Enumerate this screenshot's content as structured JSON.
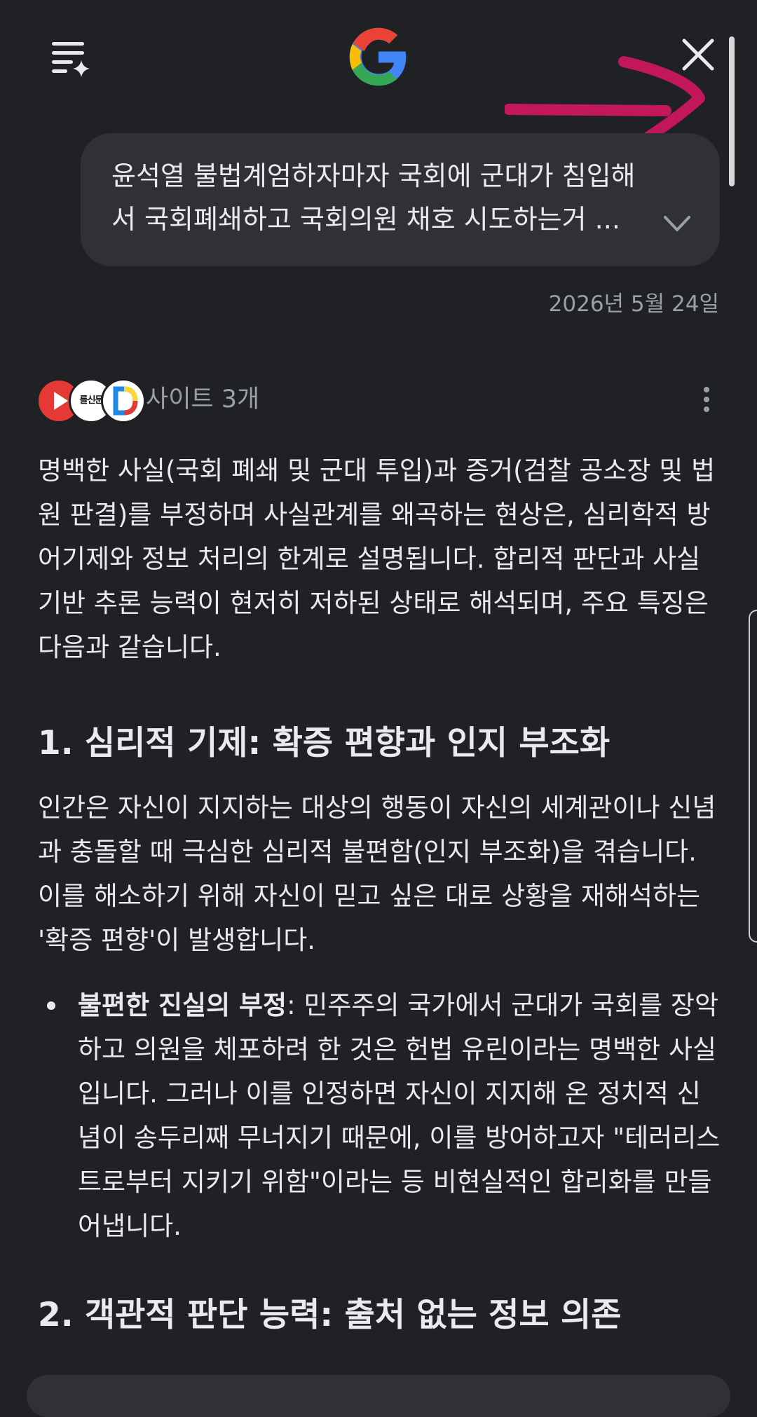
{
  "header": {
    "menu_icon": "menu-sparkle-icon",
    "logo_icon": "google-g-icon",
    "close_icon": "close-icon"
  },
  "query": {
    "text": "윤석열 불법계엄하자마자 국회에 군대가 침입해서 국회폐쇄하고 국회의원 채호 시도하는거 ...",
    "line1": "윤석열 불법계엄하자마자 국회에 군대가 침입해",
    "line2": "서 국회폐쇄하고 국회의원 채호 시도하는거 ..."
  },
  "date": "2026년 5월 24일",
  "sources": {
    "label": "사이트 3개",
    "logos": [
      "youtube",
      "신문",
      "D"
    ],
    "news_logo_text": "를신문"
  },
  "answer": {
    "intro": "명백한 사실(국회 폐쇄 및 군대 투입)과 증거(검찰 공소장 및 법원 판결)를 부정하며 사실관계를 왜곡하는 현상은, 심리학적 방어기제와 정보 처리의 한계로 설명됩니다. 합리적 판단과 사실 기반 추론 능력이 현저히 저하된 상태로 해석되며, 주요 특징은 다음과 같습니다.",
    "heading1": "1. 심리적 기제: 확증 편향과 인지 부조화",
    "para1": "인간은 자신이 지지하는 대상의 행동이 자신의 세계관이나 신념과 충돌할 때 극심한 심리적 불편함(인지 부조화)을 겪습니다. 이를 해소하기 위해 자신이 믿고 싶은 대로 상황을 재해석하는 '확증 편향'이 발생합니다.",
    "bullet1_term": "불편한 진실의 부정",
    "bullet1_text": ": 민주주의 국가에서 군대가 국회를 장악하고 의원을 체포하려 한 것은 헌법 유린이라는 명백한 사실입니다. 그러나 이를 인정하면 자신이 지지해 온 정치적 신념이 송두리째 무너지기 때문에, 이를 방어하고자 \"테러리스트로부터 지키기 위함\"이라는 등 비현실적인 합리화를 만들어냅니다.",
    "heading2": "2. 객관적 판단 능력: 출처 없는 정보 의존"
  },
  "colors": {
    "background": "#202124",
    "bubble": "#303134",
    "text": "#e8eaed",
    "muted": "#9aa0a6",
    "annotation_arrow": "#c2185b"
  }
}
